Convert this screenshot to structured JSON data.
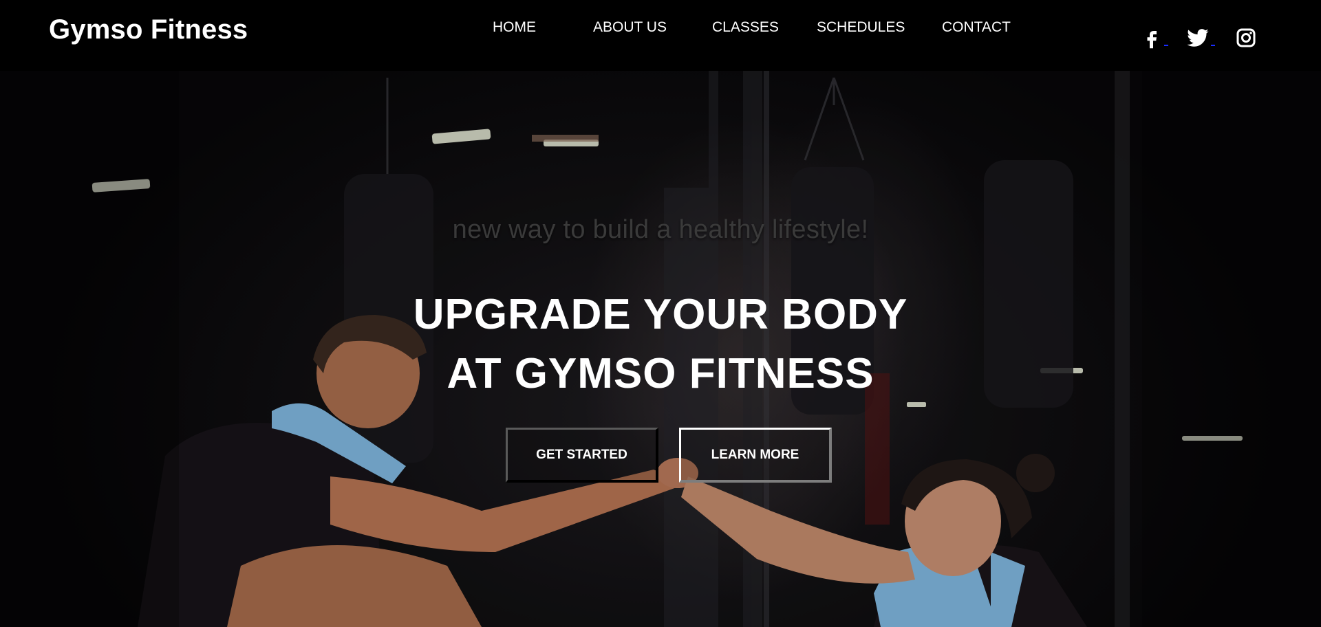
{
  "brand": {
    "name": "Gymso Fitness"
  },
  "nav": {
    "home": "HOME",
    "about": "ABOUT US",
    "classes": "CLASSES",
    "schedules": "SCHEDULES",
    "contact": "CONTACT"
  },
  "social": {
    "icons": [
      "facebook-icon",
      "twitter-icon",
      "instagram-icon"
    ]
  },
  "hero": {
    "tagline": "new way to build a healthy lifestyle!",
    "headline_line1": "UPGRADE YOUR BODY",
    "headline_line2": "AT GYMSO FITNESS",
    "primary_button": "GET STARTED",
    "secondary_button": "LEARN MORE"
  },
  "colors": {
    "header_bg": "#000000",
    "text": "#ffffff",
    "tagline": "#3a3a3a",
    "towel": "#7fb6dd"
  }
}
